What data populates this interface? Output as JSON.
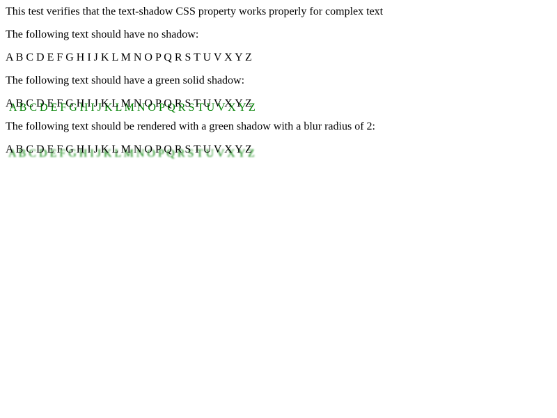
{
  "doc": {
    "intro": "This test verifies that the text-shadow CSS property works properly for complex text",
    "sections": [
      {
        "label": "The following text should have no shadow:",
        "sample": "A B C D E F G H I J K L M N O P Q R S T U V X Y Z"
      },
      {
        "label": "The following text should have a green solid shadow:",
        "sample": "A B C D E F G H I J K L M N O P Q R S T U V X Y Z"
      },
      {
        "label": "The following text should be rendered with a green shadow with a blur radius of 2:",
        "sample": "A B C D E F G H I J K L M N O P Q R S T U V X Y Z"
      }
    ],
    "colors": {
      "shadow": "#008000"
    }
  }
}
